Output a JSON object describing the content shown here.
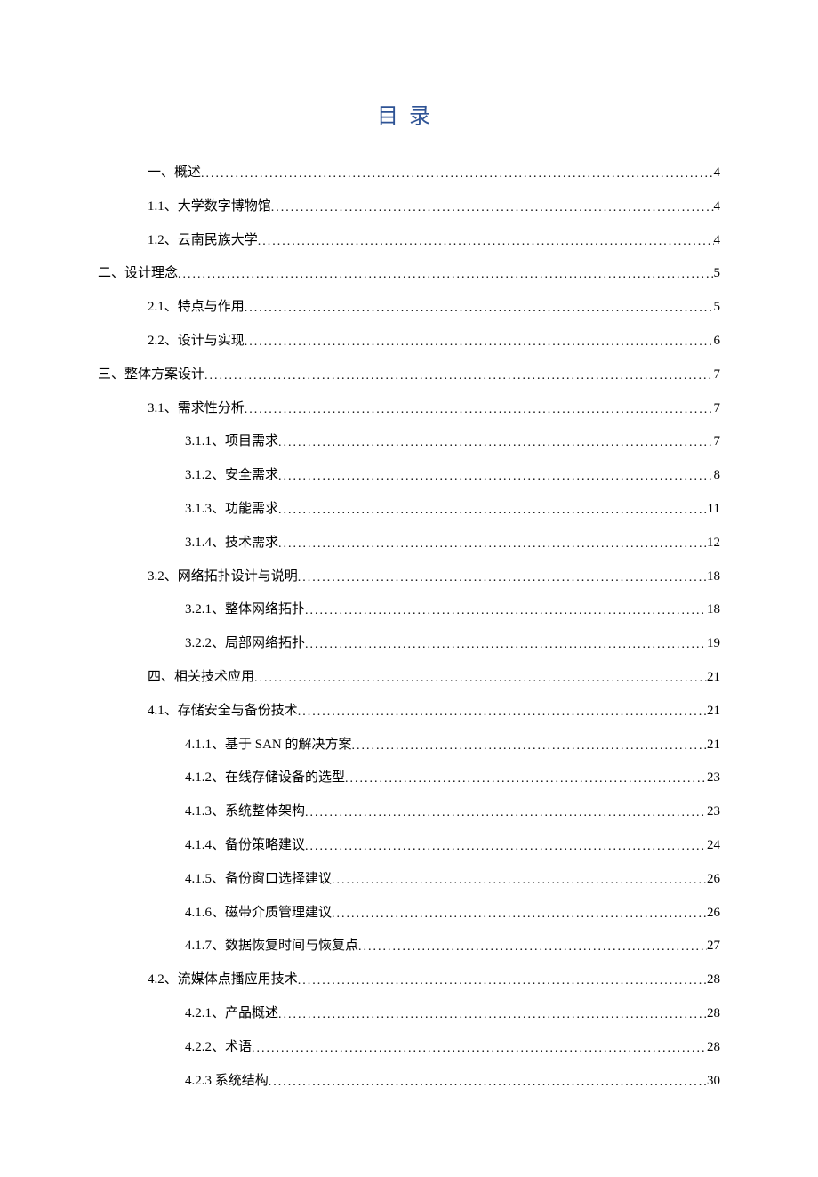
{
  "title": "目录",
  "entries": [
    {
      "label": "一、概述",
      "page": "4",
      "indent": 1
    },
    {
      "label": "1.1、大学数字博物馆",
      "page": "4",
      "indent": 1
    },
    {
      "label": "1.2、云南民族大学",
      "page": "4",
      "indent": 1
    },
    {
      "label": "二、设计理念",
      "page": "5",
      "indent": 0
    },
    {
      "label": "2.1、特点与作用",
      "page": "5",
      "indent": 1
    },
    {
      "label": "2.2、设计与实现",
      "page": "6",
      "indent": 1
    },
    {
      "label": "三、整体方案设计",
      "page": "7",
      "indent": 0
    },
    {
      "label": "3.1、需求性分析",
      "page": "7",
      "indent": 1
    },
    {
      "label": "3.1.1、项目需求",
      "page": "7",
      "indent": 2
    },
    {
      "label": "3.1.2、安全需求",
      "page": "8",
      "indent": 2
    },
    {
      "label": "3.1.3、功能需求",
      "page": "11",
      "indent": 2
    },
    {
      "label": "3.1.4、技术需求",
      "page": "12",
      "indent": 2
    },
    {
      "label": "3.2、网络拓扑设计与说明",
      "page": "18",
      "indent": 1
    },
    {
      "label": "3.2.1、整体网络拓扑",
      "page": "18",
      "indent": 2
    },
    {
      "label": "3.2.2、局部网络拓扑",
      "page": "19",
      "indent": 2
    },
    {
      "label": "四、相关技术应用",
      "page": "21",
      "indent": 1
    },
    {
      "label": "4.1、存储安全与备份技术",
      "page": "21",
      "indent": 1
    },
    {
      "label": "4.1.1、基于 SAN 的解决方案",
      "page": "21",
      "indent": 2
    },
    {
      "label": "4.1.2、在线存储设备的选型",
      "page": "23",
      "indent": 2
    },
    {
      "label": "4.1.3、系统整体架构",
      "page": "23",
      "indent": 2
    },
    {
      "label": "4.1.4、备份策略建议",
      "page": "24",
      "indent": 2
    },
    {
      "label": "4.1.5、备份窗口选择建议",
      "page": "26",
      "indent": 2
    },
    {
      "label": "4.1.6、磁带介质管理建议",
      "page": "26",
      "indent": 2
    },
    {
      "label": "4.1.7、数据恢复时间与恢复点",
      "page": "27",
      "indent": 2
    },
    {
      "label": "4.2、流媒体点播应用技术",
      "page": "28",
      "indent": 1
    },
    {
      "label": "4.2.1、产品概述",
      "page": "28",
      "indent": 2
    },
    {
      "label": "4.2.2、术语",
      "page": "28",
      "indent": 2
    },
    {
      "label": "4.2.3 系统结构 ",
      "page": "30",
      "indent": 2
    }
  ]
}
